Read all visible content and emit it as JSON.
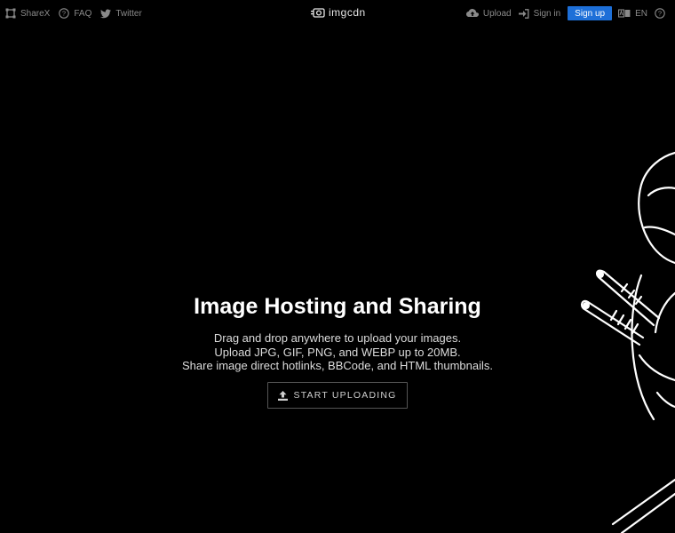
{
  "nav_left": [
    {
      "label": "ShareX",
      "icon": "sharex-icon"
    },
    {
      "label": "FAQ",
      "icon": "question-circle-icon"
    },
    {
      "label": "Twitter",
      "icon": "twitter-icon"
    }
  ],
  "brand": {
    "name": "imgcdn",
    "icon": "camera-icon"
  },
  "nav_right": {
    "upload_label": "Upload",
    "signin_label": "Sign in",
    "signup_label": "Sign up",
    "language_label": "EN",
    "help_icon": "help-icon"
  },
  "hero": {
    "title": "Image Hosting and Sharing",
    "desc_line1": "Drag and drop anywhere to upload your images.",
    "desc_line2": "Upload JPG, GIF, PNG, and WEBP up to 20MB.",
    "desc_line3": "Share image direct hotlinks, BBCode, and HTML thumbnails.",
    "button_label": "START UPLOADING"
  },
  "colors": {
    "background": "#000000",
    "accent": "#1d6fd8",
    "nav_text": "#8a8a8a"
  }
}
